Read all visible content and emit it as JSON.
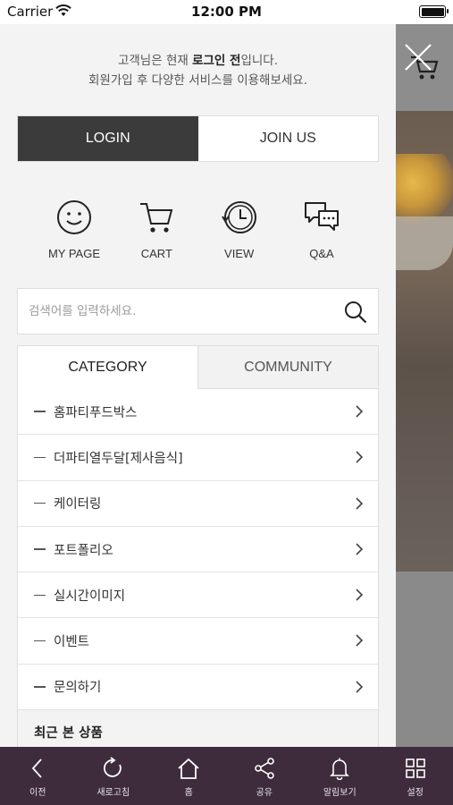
{
  "status_bar": {
    "carrier": "Carrier",
    "time": "12:00 PM"
  },
  "drawer": {
    "notice_line1_prefix": "고객님은 현재 ",
    "notice_line1_bold": "로그인 전",
    "notice_line1_suffix": "입니다.",
    "notice_line2": "회원가입 후 다양한 서비스를 이용해보세요.",
    "login_label": "LOGIN",
    "join_label": "JOIN US",
    "quick_links": [
      {
        "label": "MY PAGE",
        "icon": "smiley-icon"
      },
      {
        "label": "CART",
        "icon": "cart-icon"
      },
      {
        "label": "VIEW",
        "icon": "history-clock-icon"
      },
      {
        "label": "Q&A",
        "icon": "chat-bubbles-icon"
      }
    ],
    "search": {
      "placeholder": "검색어를 입력하세요."
    },
    "tabs": {
      "category": "CATEGORY",
      "community": "COMMUNITY"
    },
    "categories": [
      "홈파티푸드박스",
      "더파티열두달[제사음식]",
      "케이터링",
      "포트폴리오",
      "실시간이미지",
      "이벤트",
      "문의하기"
    ],
    "recent_title": "최근 본 상품"
  },
  "bottom_nav": [
    {
      "label": "이전",
      "icon": "back-arrow-icon"
    },
    {
      "label": "새로고침",
      "icon": "refresh-icon"
    },
    {
      "label": "홈",
      "icon": "home-icon"
    },
    {
      "label": "공유",
      "icon": "share-icon"
    },
    {
      "label": "알림보기",
      "icon": "bell-icon"
    },
    {
      "label": "설정",
      "icon": "grid-icon"
    }
  ],
  "colors": {
    "login_bg": "#3b3b3b",
    "bottom_bar_bg": "#3e2c3c",
    "drawer_bg": "#f3f3f3"
  }
}
